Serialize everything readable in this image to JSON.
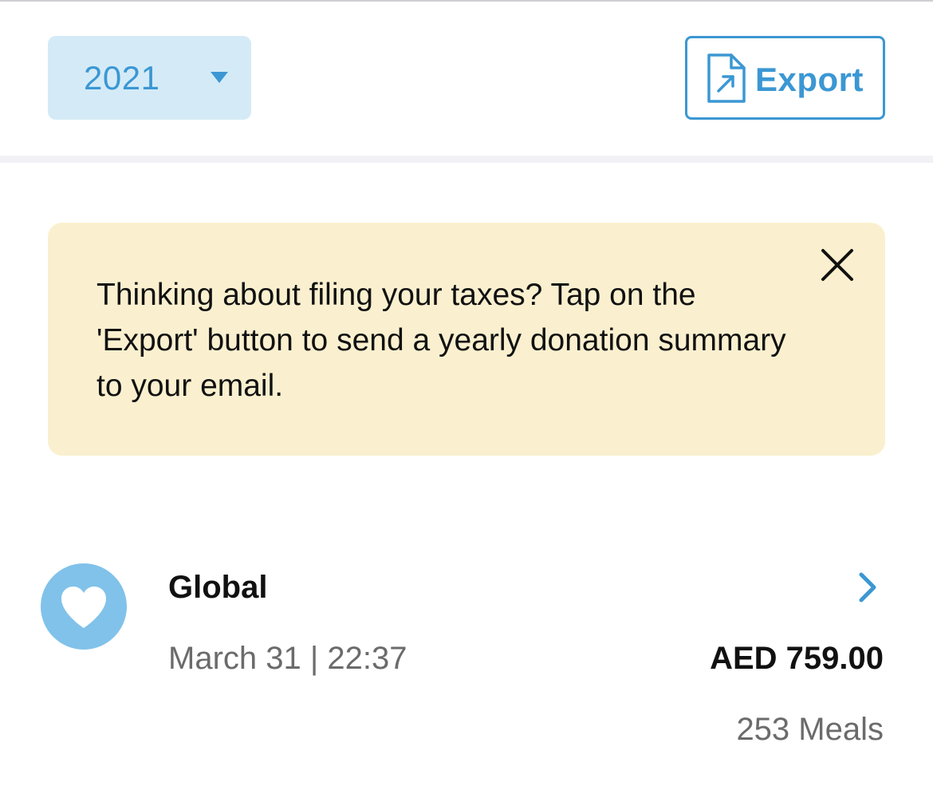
{
  "filter": {
    "year": "2021",
    "icon": "caret-down-icon"
  },
  "export": {
    "label": "Export",
    "icon": "export-file-icon"
  },
  "tip": {
    "text": "Thinking about filing your taxes? Tap on the 'Export' button to send a yearly donation summary to your email.",
    "close_icon": "close-icon"
  },
  "donations": [
    {
      "cause": "Global",
      "date": "March 31",
      "time": "22:37",
      "datetime": "March 31 | 22:37",
      "amount": "AED 759.00",
      "meals": "253 Meals",
      "icon": "heart-icon"
    }
  ],
  "colors": {
    "accent": "#3b97d3",
    "select_bg": "#d4ebf7",
    "tip_bg": "#faf0cf",
    "avatar_bg": "#80c2ea",
    "muted_text": "#6b6b6b"
  }
}
